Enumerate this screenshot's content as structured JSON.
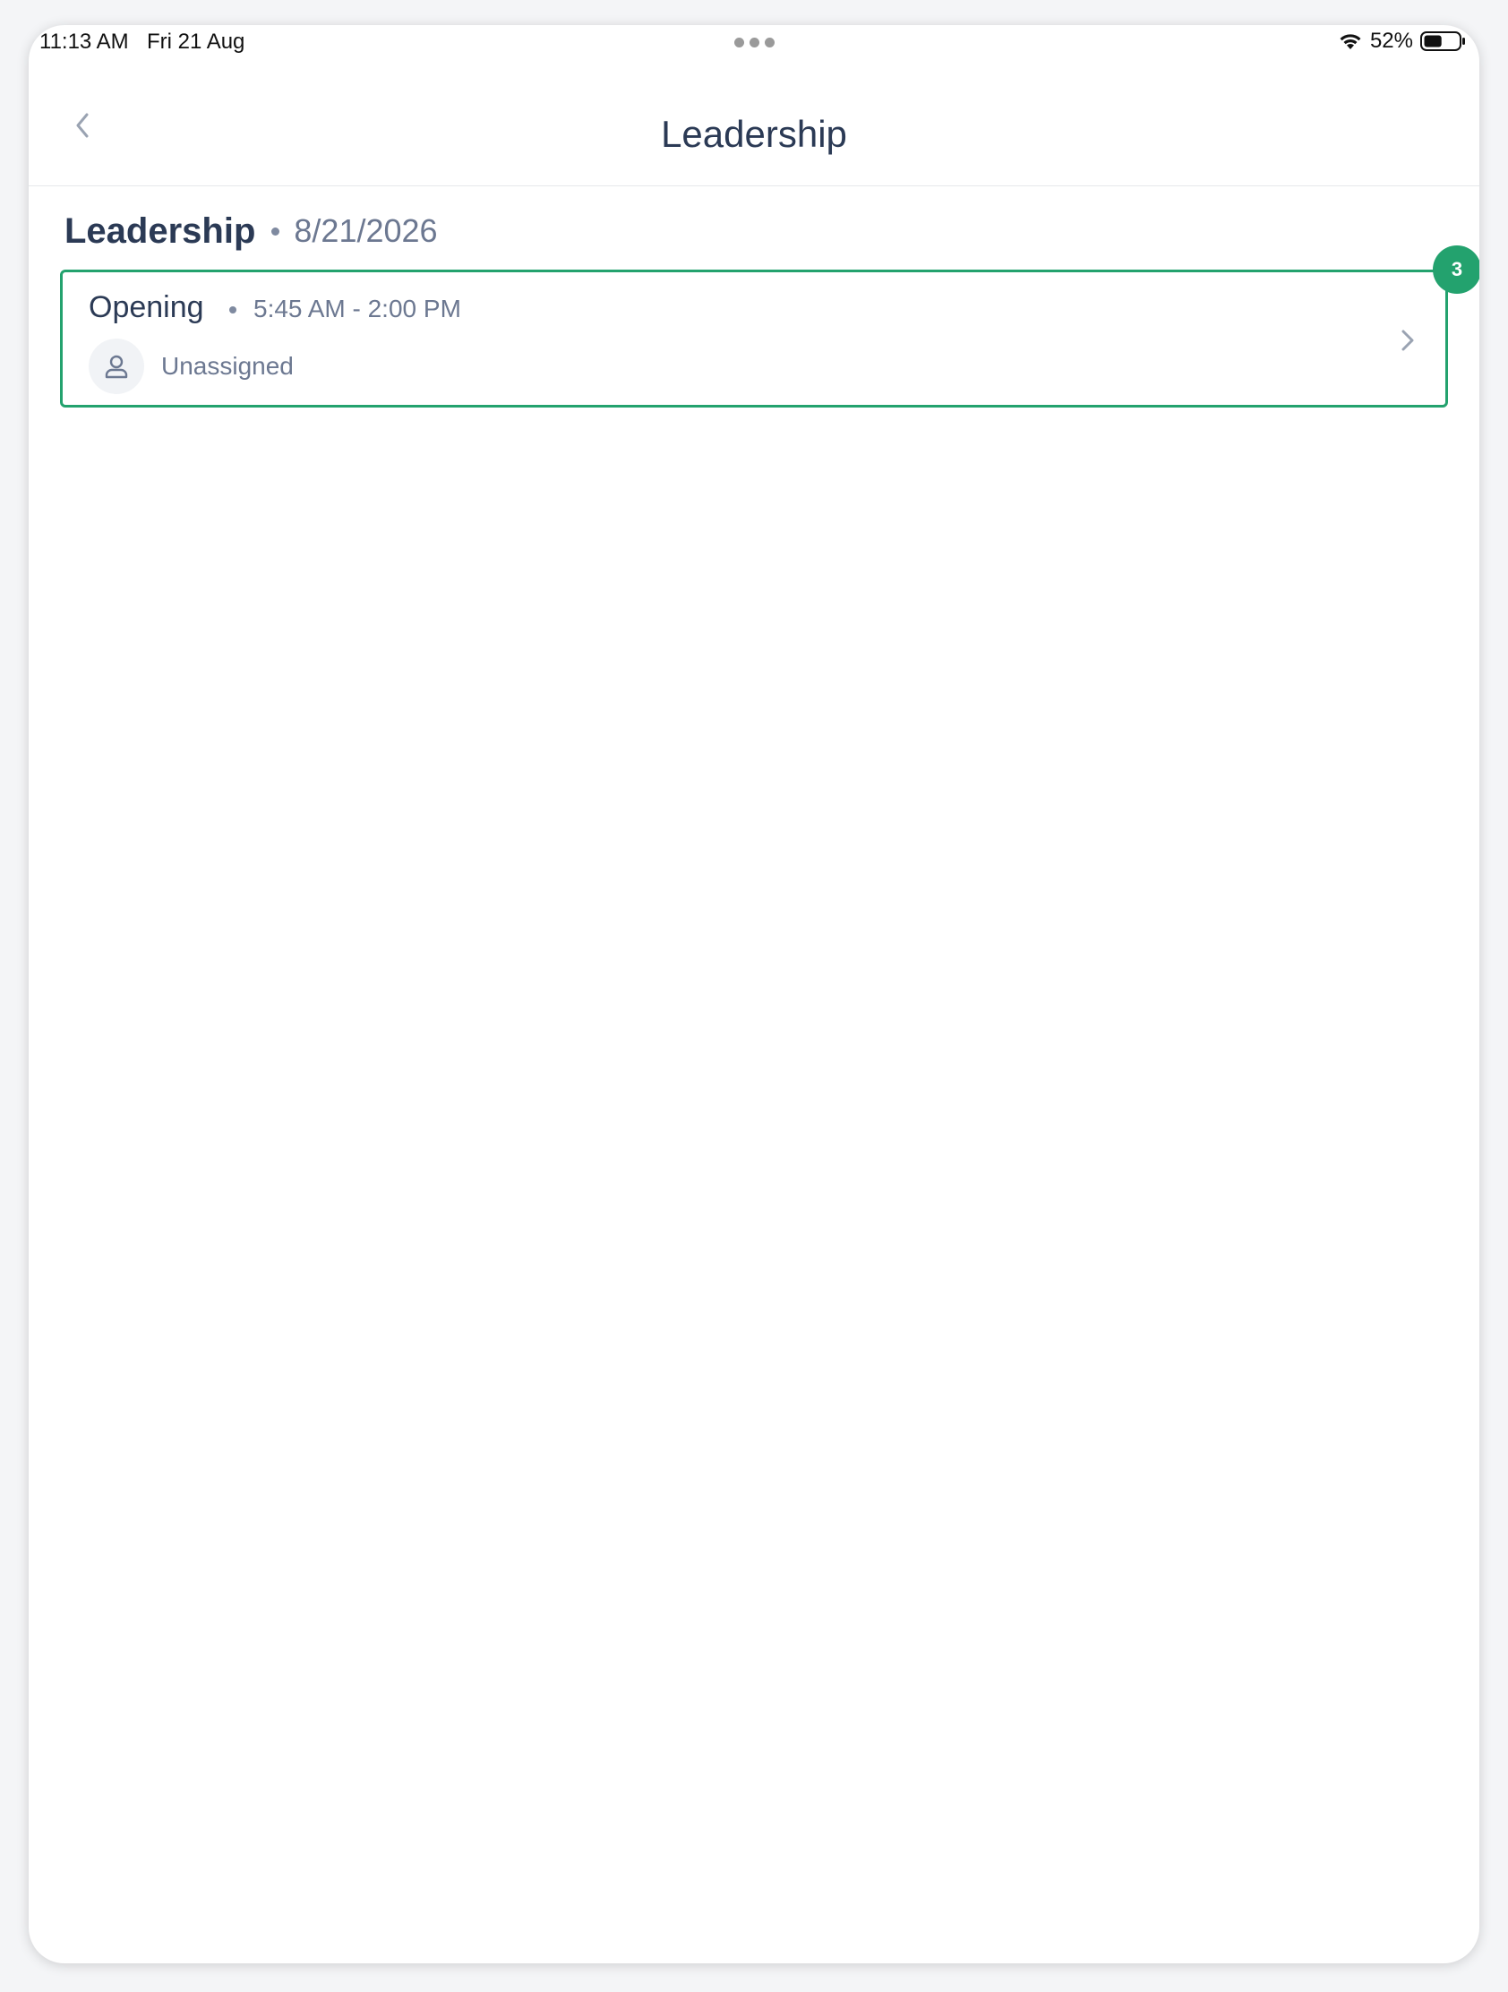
{
  "status_bar": {
    "time": "11:13 AM",
    "date": "Fri 21 Aug",
    "battery_percent": "52%",
    "battery_level": 0.52,
    "icons": [
      "wifi-icon",
      "battery-icon"
    ]
  },
  "nav": {
    "title": "Leadership",
    "back_icon": "chevron-left-icon"
  },
  "section": {
    "title": "Leadership",
    "date": "8/21/2026"
  },
  "shifts": [
    {
      "name": "Opening",
      "time": "5:45 AM - 2:00 PM",
      "assignee": "Unassigned",
      "badge_count": "3",
      "avatar_icon": "user-icon",
      "chevron_icon": "chevron-right-icon"
    }
  ],
  "colors": {
    "accent": "#23a26e",
    "title_text": "#2b3a55",
    "muted_text": "#6c7891"
  }
}
